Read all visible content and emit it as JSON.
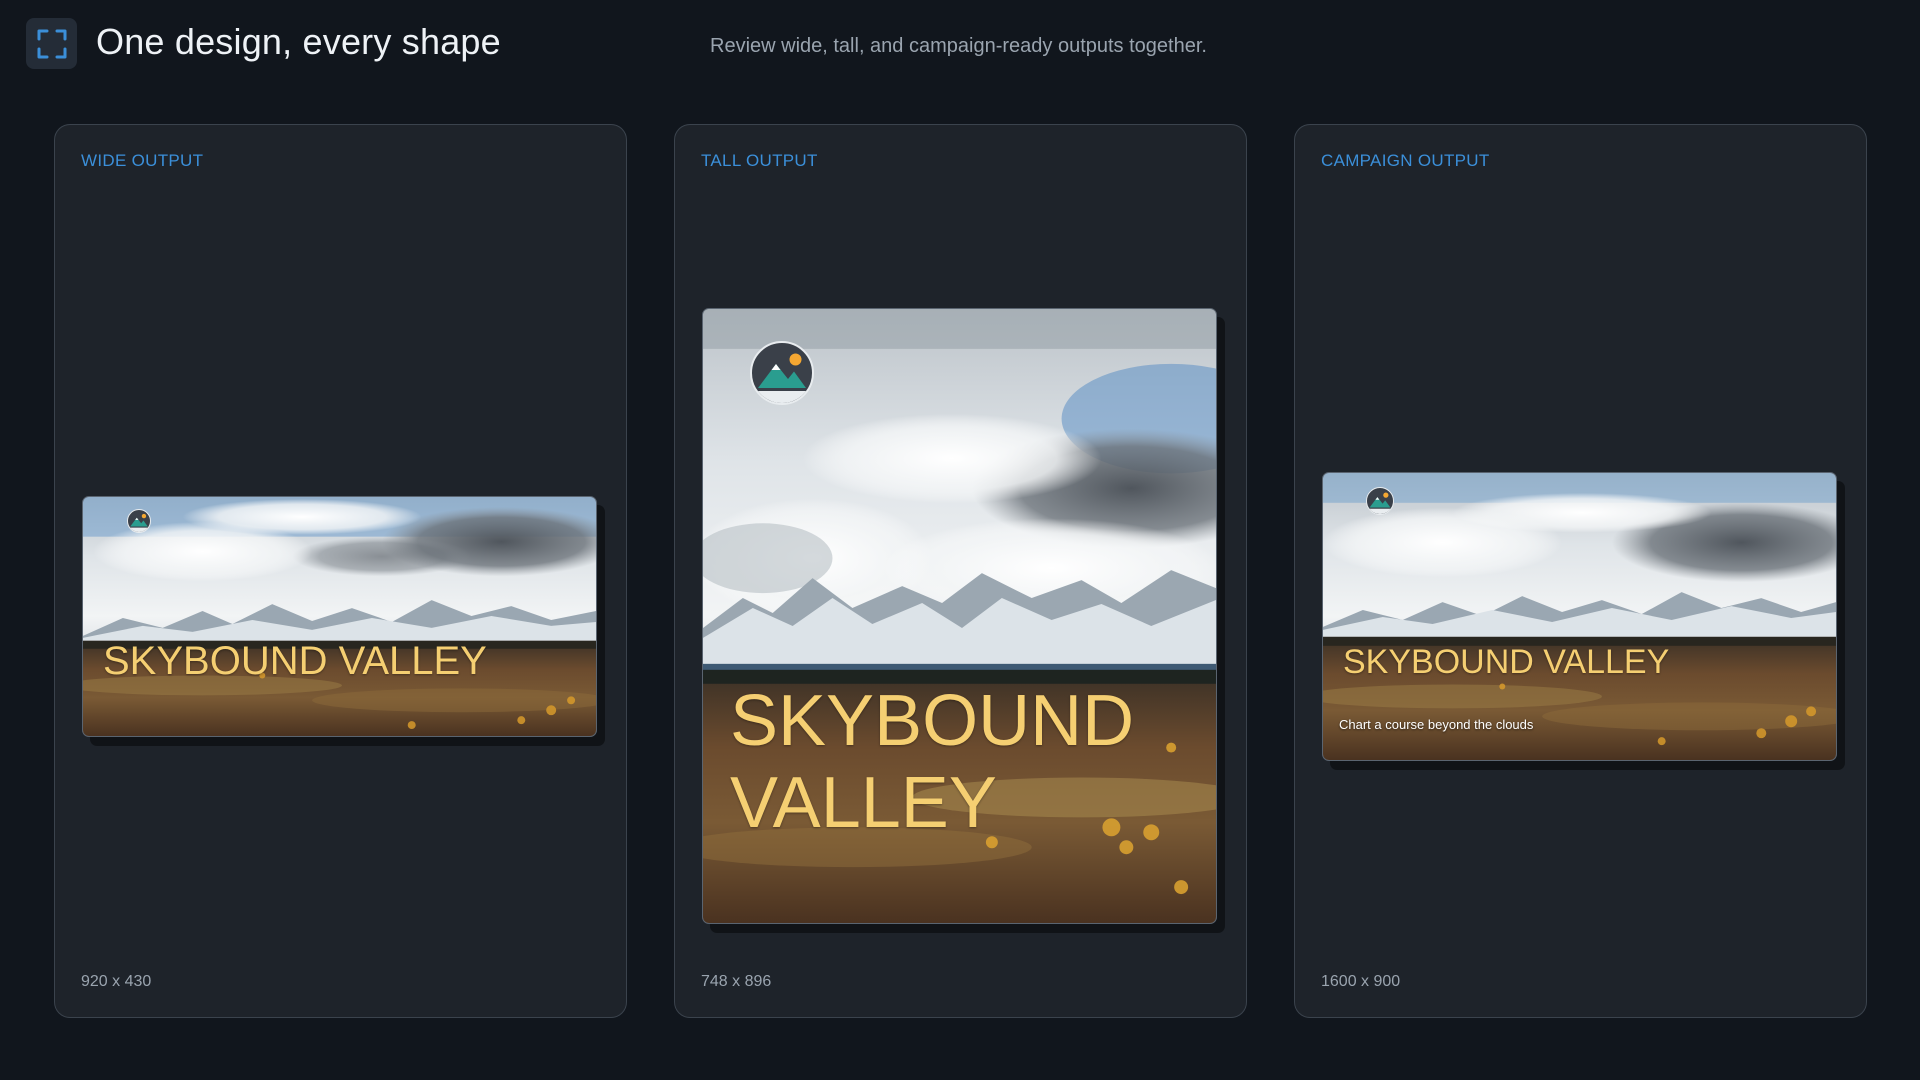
{
  "header": {
    "title": "One design, every shape",
    "subtitle": "Review wide, tall, and campaign-ready outputs together.",
    "icon": "expand-frame-icon",
    "accent": "#3b8fd9"
  },
  "panels": [
    {
      "label": "WIDE OUTPUT",
      "size": "920 x 430",
      "headline": "SKYBOUND VALLEY"
    },
    {
      "label": "TALL OUTPUT",
      "size": "748 x 896",
      "headline_line1": "SKYBOUND",
      "headline_line2": "VALLEY"
    },
    {
      "label": "CAMPAIGN OUTPUT",
      "size": "1600 x 900",
      "headline": "SKYBOUND VALLEY",
      "tagline": "Chart a course beyond the clouds"
    }
  ],
  "colors": {
    "headline": "#f5cf72",
    "panel_label": "#3b8fd9",
    "background": "#11161d",
    "panel": "#1e232a"
  },
  "logo_icon": "mountain-logo-icon",
  "scene_image": "mountain-valley-landscape"
}
